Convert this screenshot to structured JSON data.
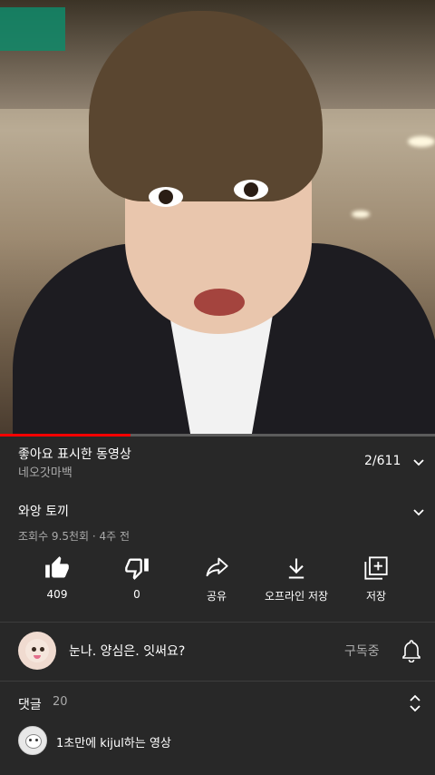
{
  "video": {
    "progress_fraction": 0.3
  },
  "playlist": {
    "title": "좋아요 표시한 동영상",
    "channel": "네오갓마백",
    "position": "2/611"
  },
  "video_info": {
    "title": "와앙 토끼",
    "meta": "조회수 9.5천회 · 4주 전"
  },
  "actions": {
    "like_count": "409",
    "dislike_count": "0",
    "share": "공유",
    "download": "오프라인 저장",
    "save": "저장"
  },
  "channel": {
    "name": "눈나. 양심은. 잇써요?",
    "subscribe_status": "구독중"
  },
  "comments": {
    "label": "댓글",
    "count": "20",
    "preview": "1초만에 kijul하는 영상"
  },
  "colors": {
    "background": "#282828",
    "progress": "#ff0000",
    "secondary_text": "#aaaaaa"
  },
  "icons": [
    "like-icon",
    "dislike-icon",
    "share-icon",
    "download-icon",
    "save-playlist-icon",
    "bell-icon",
    "chevron-down-icon",
    "expand-icon"
  ]
}
